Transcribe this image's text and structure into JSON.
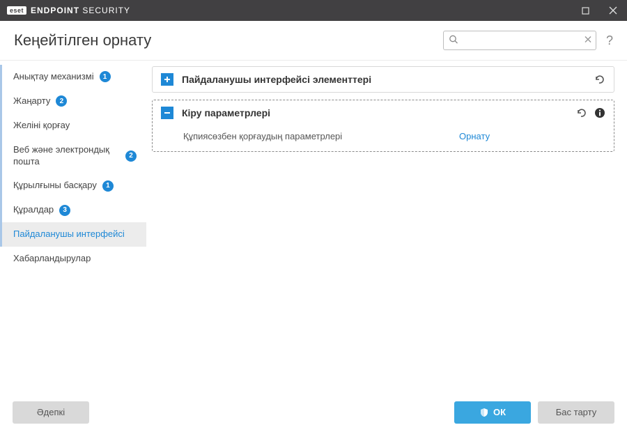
{
  "titlebar": {
    "logo_text": "eset",
    "product_bold": "ENDPOINT",
    "product_thin": "SECURITY"
  },
  "header": {
    "title": "Кеңейтілген орнату",
    "search_value": "",
    "help": "?"
  },
  "sidebar": {
    "items": [
      {
        "label": "Анықтау механизмі",
        "badge": "1",
        "bluebar": true
      },
      {
        "label": "Жаңарту",
        "badge": "2",
        "bluebar": true
      },
      {
        "label": "Желіні қорғау",
        "badge": null,
        "bluebar": true
      },
      {
        "label": "Веб және электрондық пошта",
        "badge": "2",
        "bluebar": true
      },
      {
        "label": "Құрылғыны басқару",
        "badge": "1",
        "bluebar": true
      },
      {
        "label": "Құралдар",
        "badge": "3",
        "bluebar": true
      },
      {
        "label": "Пайдаланушы интерфейсі",
        "badge": null,
        "bluebar": true,
        "active": true
      },
      {
        "label": "Хабарландырулар",
        "badge": null,
        "bluebar": false
      }
    ]
  },
  "panels": {
    "ui_elements": {
      "title": "Пайдаланушы интерфейсі элементтері"
    },
    "access_setup": {
      "title": "Кіру параметрлері",
      "setting_label": "Құпиясөзбен қорғаудың параметрлері",
      "setting_action": "Орнату"
    }
  },
  "footer": {
    "default": "Әдепкі",
    "ok": "ОК",
    "cancel": "Бас тарту"
  }
}
